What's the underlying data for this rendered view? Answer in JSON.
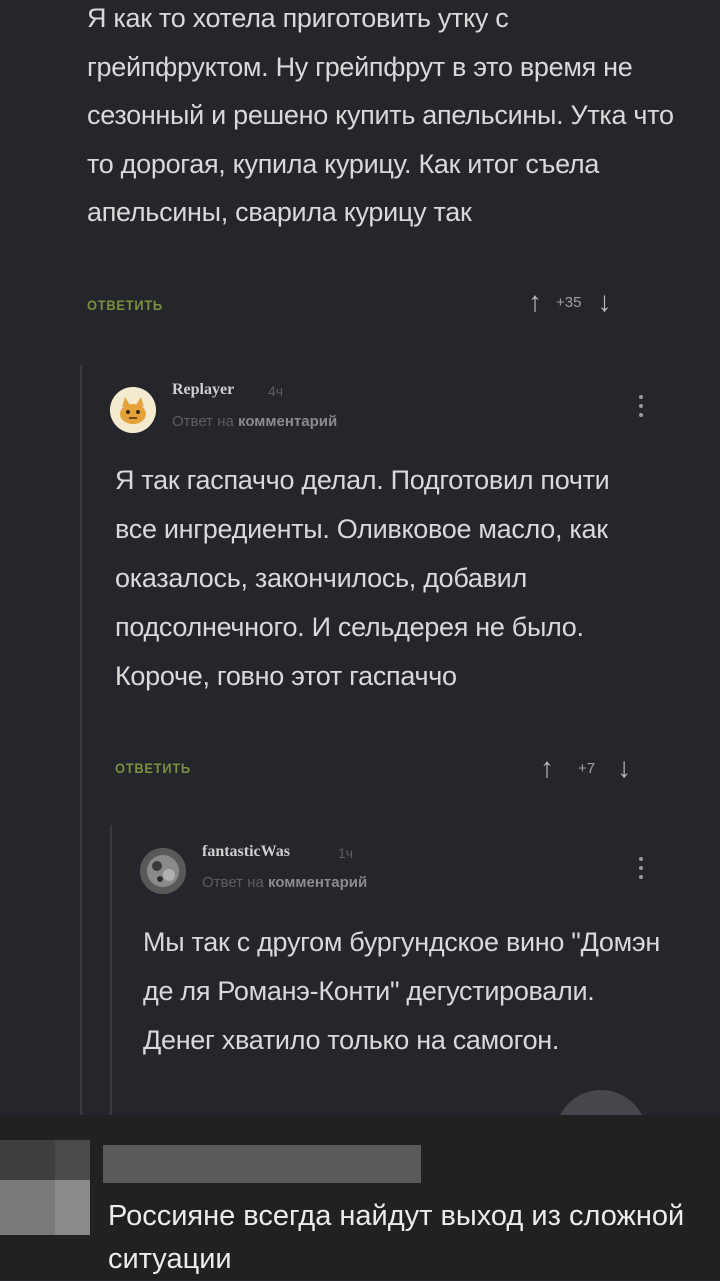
{
  "comments": [
    {
      "text": "Я как то хотела приготовить утку с грейпфруктом. Ну грейпфрут в это время не сезонный и решено купить апельсины. Утка что то дорогая, купила курицу. Как итог съела апельсины, сварила курицу так",
      "reply_label": "ОТВЕТИТЬ",
      "score": "+35"
    },
    {
      "username": "Replayer",
      "time": "4ч",
      "meta_prefix": "Ответ на",
      "meta_link": "комментарий",
      "text": "Я так гаспаччо делал. Подготовил почти все ингредиенты. Оливковое масло, как оказалось, закончилось, добавил подсолнечного. И сельдерея не было. Короче, говно этот гаспаччо",
      "reply_label": "ОТВЕТИТЬ",
      "score": "+7"
    },
    {
      "username": "fantasticWas",
      "time": "1ч",
      "meta_prefix": "Ответ на",
      "meta_link": "комментарий",
      "text": "Мы так с другом бургундское вино \"Домэн де ля Романэ-Конти\" дегустировали. Денег хватило только на самогон."
    }
  ],
  "icons": {
    "upvote": "arrow-up-icon",
    "downvote": "arrow-down-icon",
    "more": "kebab-menu-icon"
  },
  "overlay": {
    "caption": "Россияне всегда найдут выход из сложной\nситуации"
  },
  "colors": {
    "background": "#25262b",
    "reply_accent": "#7b8f3e",
    "overlay_bg": "#212121"
  }
}
